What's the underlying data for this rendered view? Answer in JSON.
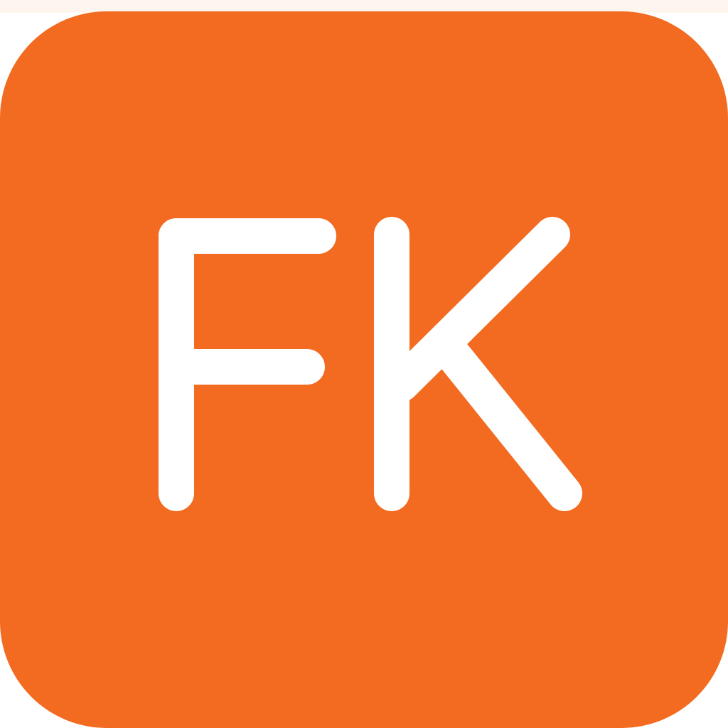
{
  "app_icon": {
    "monogram": "FK",
    "background_color": "#f26b21",
    "letter_color": "#ffffff",
    "top_strip_color": "#fef6ee"
  }
}
